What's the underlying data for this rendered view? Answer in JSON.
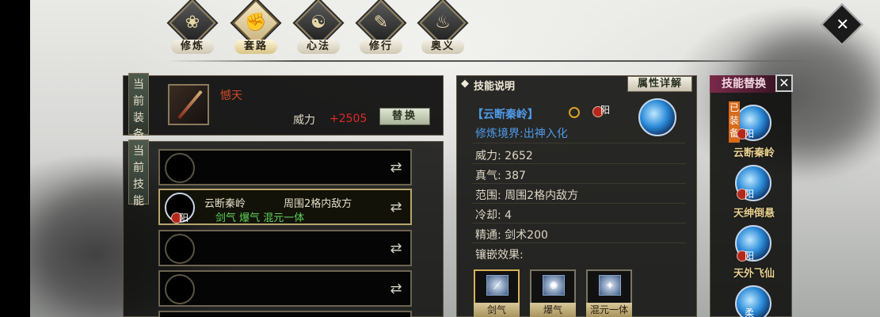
{
  "tabs": [
    {
      "label": "修炼",
      "icon": "lotus-icon",
      "glyph": "❀",
      "active": false
    },
    {
      "label": "套路",
      "icon": "fist-icon",
      "glyph": "✊",
      "active": true
    },
    {
      "label": "心法",
      "icon": "swirl-icon",
      "glyph": "☯",
      "active": false
    },
    {
      "label": "修行",
      "icon": "scroll-icon",
      "glyph": "✎",
      "active": false
    },
    {
      "label": "奥义",
      "icon": "flame-icon",
      "glyph": "♨",
      "active": false
    }
  ],
  "equipment": {
    "section_label": "当前装备",
    "name": "憾天",
    "power_label": "威力",
    "power_bonus": "+2505",
    "replace_button": "替换"
  },
  "skills_section": {
    "section_label": "当前技能",
    "selected": {
      "name": "云断秦岭",
      "range": "周围2格内敌方",
      "gems": "剑气 爆气 混元一体",
      "badge": "阳"
    }
  },
  "detail": {
    "title": "技能说明",
    "attr_button": "属性详解",
    "skill_name": "【云断秦岭】",
    "badge": "阳",
    "realm": "修炼境界:出神入化",
    "stats": [
      {
        "label": "威力:",
        "value": "2652"
      },
      {
        "label": "真气:",
        "value": "387"
      },
      {
        "label": "范围:",
        "value": "周围2格内敌方"
      },
      {
        "label": "冷却:",
        "value": "4"
      },
      {
        "label": "精通:",
        "value": "剑术200"
      }
    ],
    "inlay_label": "镶嵌效果:",
    "inlays": [
      "剑气",
      "爆气",
      "混元一体"
    ]
  },
  "replace_panel": {
    "title": "技能替换",
    "equipped_tag": "已装备",
    "skills": [
      {
        "name": "云断秦岭",
        "badge": "阳"
      },
      {
        "name": "天绅倒悬",
        "badge": "阳"
      },
      {
        "name": "天外飞仙",
        "badge": "阳"
      },
      {
        "name": "",
        "badge": "柔"
      }
    ]
  }
}
